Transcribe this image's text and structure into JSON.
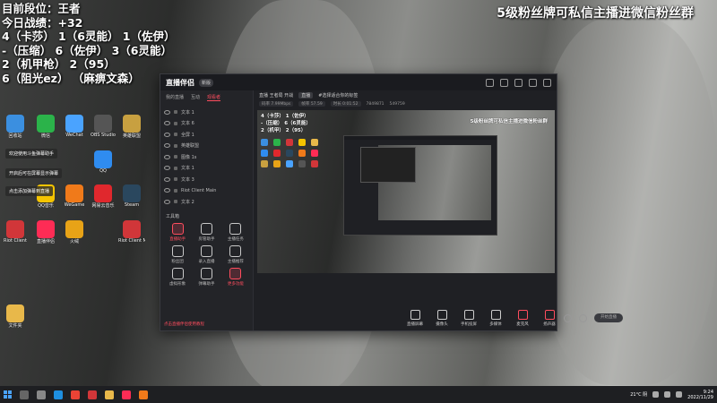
{
  "overlay": {
    "left_lines": [
      "目前段位：王者",
      "今日战绩：+32",
      "4（卡莎） 1（6灵能） 1（佐伊）",
      "-（压缩） 6（佐伊） 3（6灵能）",
      "2（机甲枪） 2（95）",
      "6（阻光ez） （麻痹文森）"
    ],
    "right_text": "5级粉丝牌可私信主播进微信粉丝群"
  },
  "desktop_icons": [
    {
      "label": "回收站",
      "color": "#3b8fe0"
    },
    {
      "label": "微信",
      "color": "#2bb34a"
    },
    {
      "label": "WeChat",
      "color": "#4aa3ff"
    },
    {
      "label": "OBS Studio",
      "color": "#555555"
    },
    {
      "label": "英雄联盟",
      "color": "#c8a040"
    },
    {
      "label": "QQ",
      "color": "#2f8cf0"
    },
    {
      "label": "网易云音乐",
      "color": "#e0282d"
    },
    {
      "label": "Steam",
      "color": "#2a475e"
    },
    {
      "label": "QQ音乐",
      "color": "#f5c400"
    },
    {
      "label": "WeGame",
      "color": "#f07a1a"
    },
    {
      "label": "Riot Client",
      "color": "#d13639"
    },
    {
      "label": "直播伴侣",
      "color": "#fe2c55"
    },
    {
      "label": "火绒",
      "color": "#e8a317"
    },
    {
      "label": "Riot Client Main",
      "color": "#d13639"
    },
    {
      "label": "文件夹",
      "color": "#e8b84a"
    }
  ],
  "app": {
    "logo": "直播伴侣",
    "badge": "新版",
    "tabs": [
      "我的直播",
      "互动",
      "观看者"
    ],
    "active_tab": "观看者",
    "scenes": [
      "文本 1",
      "文本 6",
      "全屏 1",
      "英雄联盟",
      "图像 1s",
      "文本 1",
      "文本 3",
      "Riot Client Main",
      "文本 2"
    ],
    "tools_label": "工具箱",
    "tools": [
      {
        "label": "直播助手",
        "red": true
      },
      {
        "label": "房管助手",
        "red": false
      },
      {
        "label": "主播任务",
        "red": false
      },
      {
        "label": "粉丝团",
        "red": false
      },
      {
        "label": "录入直播",
        "red": false
      },
      {
        "label": "主播推荐",
        "red": false
      },
      {
        "label": "虚拟形象",
        "red": false
      },
      {
        "label": "弹幕助手",
        "red": false
      },
      {
        "label": "更多功能",
        "red": true
      }
    ],
    "sidebar_footer": "点击直播伴侣使用教程",
    "info": {
      "host": "直播 王者局 开战",
      "tag": "直播",
      "category": "#选择适合你的标签"
    },
    "stats": {
      "bitrate": "码率 7.99Mbps",
      "fps": "帧率 57.59",
      "time": "时长 0:01:52",
      "followers": "7849871",
      "likes": "549759"
    },
    "preview_overlay": "5级粉丝牌可私信主播进微信粉丝群",
    "preview_lines": [
      "4（卡莎） 1（佐伊）",
      "-（压缩） 6（6灵能）",
      "2（机甲） 2（95）"
    ],
    "bottom_items": [
      {
        "label": "直播屏幕",
        "red": false
      },
      {
        "label": "摄像头",
        "red": false
      },
      {
        "label": "手机投屏",
        "red": false
      },
      {
        "label": "多媒体",
        "red": false
      },
      {
        "label": "麦克风",
        "red": true
      },
      {
        "label": "扬声器",
        "red": true
      }
    ],
    "start_label": "开始直播"
  },
  "toasts": [
    "欢迎使用斗鱼弹幕助手",
    "开启后可在屏幕显示弹幕",
    "点击添加弹幕到直播"
  ],
  "taskbar": {
    "time": "9:24",
    "date": "2022/11/29",
    "weather": "21°C 阴"
  }
}
